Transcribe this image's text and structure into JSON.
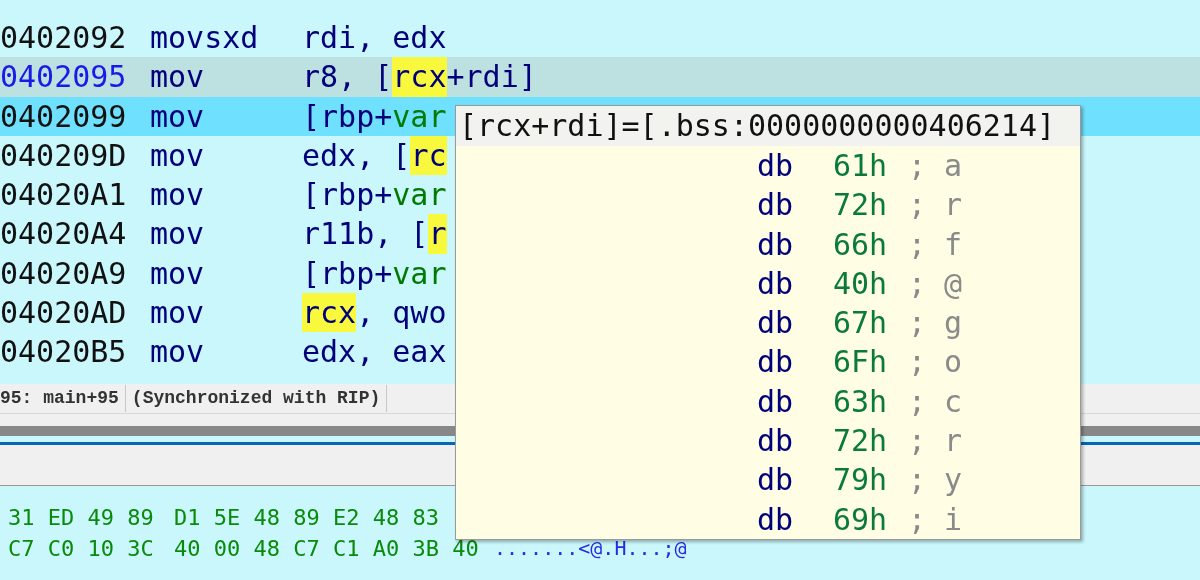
{
  "listing": {
    "rows": [
      {
        "address": "0402092",
        "mnemonic": "movsxd",
        "cursor": false,
        "ip": false,
        "operands": [
          {
            "text": "rdi, edx",
            "kind": "plain",
            "highlighted": false
          }
        ]
      },
      {
        "address": "0402095",
        "mnemonic": "mov",
        "cursor": true,
        "ip": false,
        "operands": [
          {
            "text": "r8, [",
            "kind": "plain",
            "highlighted": false
          },
          {
            "text": "rcx",
            "kind": "plain",
            "highlighted": true
          },
          {
            "text": "+rdi]",
            "kind": "plain",
            "highlighted": false
          }
        ]
      },
      {
        "address": "0402099",
        "mnemonic": "mov",
        "cursor": false,
        "ip": true,
        "operands": [
          {
            "text": "[rbp+",
            "kind": "plain",
            "highlighted": false
          },
          {
            "text": "var",
            "kind": "var",
            "highlighted": false
          }
        ]
      },
      {
        "address": "040209D",
        "mnemonic": "mov",
        "cursor": false,
        "ip": false,
        "operands": [
          {
            "text": "edx, [",
            "kind": "plain",
            "highlighted": false
          },
          {
            "text": "rc",
            "kind": "plain",
            "highlighted": true
          }
        ]
      },
      {
        "address": "04020A1",
        "mnemonic": "mov",
        "cursor": false,
        "ip": false,
        "operands": [
          {
            "text": "[rbp+",
            "kind": "plain",
            "highlighted": false
          },
          {
            "text": "var",
            "kind": "var",
            "highlighted": false
          }
        ]
      },
      {
        "address": "04020A4",
        "mnemonic": "mov",
        "cursor": false,
        "ip": false,
        "operands": [
          {
            "text": "r11b, [",
            "kind": "plain",
            "highlighted": false
          },
          {
            "text": "r",
            "kind": "plain",
            "highlighted": true
          }
        ]
      },
      {
        "address": "04020A9",
        "mnemonic": "mov",
        "cursor": false,
        "ip": false,
        "operands": [
          {
            "text": "[rbp+",
            "kind": "plain",
            "highlighted": false
          },
          {
            "text": "var",
            "kind": "var",
            "highlighted": false
          }
        ]
      },
      {
        "address": "04020AD",
        "mnemonic": "mov",
        "cursor": false,
        "ip": false,
        "operands": [
          {
            "text": "rcx",
            "kind": "plain",
            "highlighted": true
          },
          {
            "text": ", qwo",
            "kind": "plain",
            "highlighted": false
          }
        ]
      },
      {
        "address": "04020B5",
        "mnemonic": "mov",
        "cursor": false,
        "ip": false,
        "operands": [
          {
            "text": "edx, eax",
            "kind": "plain",
            "highlighted": false
          }
        ]
      }
    ]
  },
  "status_bar": {
    "location": "95: main+95",
    "sync": "(Synchronized with RIP)"
  },
  "hex_view": {
    "rows": [
      {
        "bytes_1": "31 ED 49 89",
        "bytes_2": "D1 5E 48 89 E2 48 83"
      },
      {
        "bytes_1": "C7 C0 10 3C",
        "bytes_2": "40 00 48 C7 C1 A0 3B 40",
        "ascii": ".......<@.H...;@"
      }
    ]
  },
  "tooltip": {
    "title": "[rcx+rdi]=[.bss:0000000000406214]",
    "rows": [
      {
        "directive": "db",
        "value": "61h",
        "comment": "; a"
      },
      {
        "directive": "db",
        "value": "72h",
        "comment": "; r"
      },
      {
        "directive": "db",
        "value": "66h",
        "comment": "; f"
      },
      {
        "directive": "db",
        "value": "40h",
        "comment": "; @"
      },
      {
        "directive": "db",
        "value": "67h",
        "comment": "; g"
      },
      {
        "directive": "db",
        "value": "6Fh",
        "comment": "; o"
      },
      {
        "directive": "db",
        "value": "63h",
        "comment": "; c"
      },
      {
        "directive": "db",
        "value": "72h",
        "comment": "; r"
      },
      {
        "directive": "db",
        "value": "79h",
        "comment": "; y"
      },
      {
        "directive": "db",
        "value": "69h",
        "comment": "; i"
      }
    ]
  }
}
